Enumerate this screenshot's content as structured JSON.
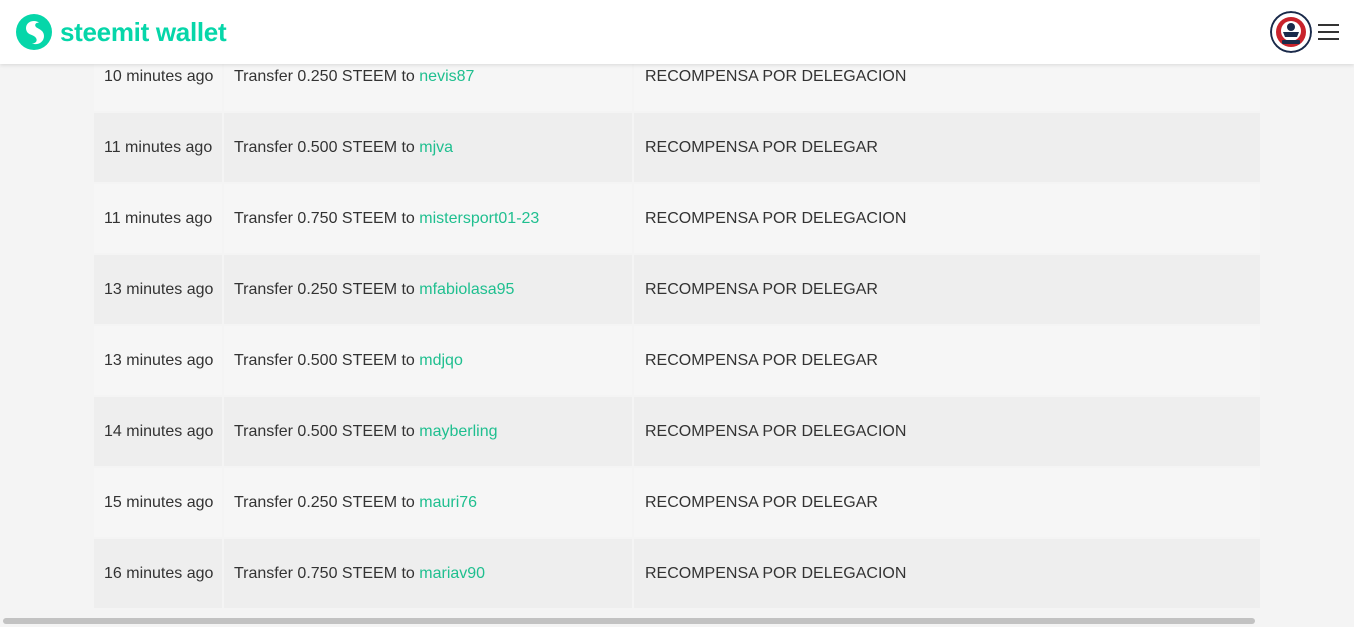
{
  "header": {
    "logo_text": "steemit wallet",
    "brand_color": "#06d6a9",
    "avatar_icon": "user-avatar",
    "menu_icon": "hamburger-menu-icon"
  },
  "transfers": [
    {
      "time": "10 minutes ago",
      "prefix": "Transfer 0.250 STEEM to",
      "user": "nevis87",
      "memo": "RECOMPENSA POR DELEGACION"
    },
    {
      "time": "11 minutes ago",
      "prefix": "Transfer 0.500 STEEM to",
      "user": "mjva",
      "memo": "RECOMPENSA POR DELEGAR"
    },
    {
      "time": "11 minutes ago",
      "prefix": "Transfer 0.750 STEEM to",
      "user": "mistersport01-23",
      "memo": "RECOMPENSA POR DELEGACION"
    },
    {
      "time": "13 minutes ago",
      "prefix": "Transfer 0.250 STEEM to",
      "user": "mfabiolasa95",
      "memo": "RECOMPENSA POR DELEGAR"
    },
    {
      "time": "13 minutes ago",
      "prefix": "Transfer 0.500 STEEM to",
      "user": "mdjqo",
      "memo": "RECOMPENSA POR DELEGAR"
    },
    {
      "time": "14 minutes ago",
      "prefix": "Transfer 0.500 STEEM to",
      "user": "mayberling",
      "memo": "RECOMPENSA POR DELEGACION"
    },
    {
      "time": "15 minutes ago",
      "prefix": "Transfer 0.250 STEEM to",
      "user": "mauri76",
      "memo": "RECOMPENSA POR DELEGAR"
    },
    {
      "time": "16 minutes ago",
      "prefix": "Transfer 0.750 STEEM to",
      "user": "mariav90",
      "memo": "RECOMPENSA POR DELEGACION"
    }
  ]
}
